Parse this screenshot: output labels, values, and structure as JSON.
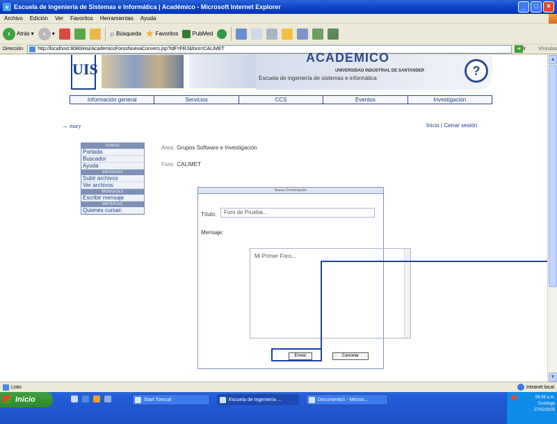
{
  "window": {
    "title": "Escuela de Ingeniería de Sistemas e Informática | Académico - Microsoft Internet Explorer"
  },
  "menubar": {
    "items": [
      "Archivo",
      "Edición",
      "Ver",
      "Favoritos",
      "Herramientas",
      "Ayuda"
    ]
  },
  "toolbar": {
    "back": "Atrás",
    "search": "Búsqueda",
    "favorites": "Favoritos",
    "pubmed": "PubMed"
  },
  "addressbar": {
    "label": "Dirección",
    "url": "http://localhost:8080/eisi/AcademicoForosNuevaConvers.jsp?idF=FRJ&foro=CALIMET",
    "go": "Ir",
    "links": "Vínculos"
  },
  "banner": {
    "logo": "UIS",
    "academico": "ACADEMICO",
    "university": "UNIVERSIDAD INDUSTRIAL DE SANTANDER",
    "school": "Escuela de ingeniería de sistemas e informática"
  },
  "nav": {
    "tabs": [
      "Información general",
      "Servicios",
      "CCS",
      "Eventos",
      "Investigación"
    ]
  },
  "user": {
    "name": "mary"
  },
  "toplinks": {
    "home": "Inicio",
    "separator": "|",
    "logout": "Cerrar sesión"
  },
  "sidemenu": {
    "sections": [
      {
        "header": "FOROS",
        "items": [
          "Portada",
          "Buscador",
          "Ayuda"
        ]
      },
      {
        "header": "ARCHIVOS",
        "items": [
          "Subir archivos",
          "Ver archivos"
        ]
      },
      {
        "header": "MENSAJES",
        "items": [
          "Escribir mensaje"
        ]
      },
      {
        "header": "MATERIAS",
        "items": [
          "Quienes cursan"
        ]
      }
    ]
  },
  "info": {
    "area_label": "Area:",
    "area_value": "Grupos Software e Investigación",
    "forum_label": "Foro:",
    "forum_value": "CALIMET"
  },
  "panel": {
    "header": "Nueva Conversación",
    "title_label": "Título:",
    "title_value": "Foro de Prueba...",
    "message_label": "Mensaje:",
    "message_value": "Mi Primer Foro...",
    "send_button": "Enviar",
    "cancel_button": "Cancelar"
  },
  "statusbar": {
    "status": "Listo",
    "zone": "Intranet local"
  },
  "taskbar": {
    "start": "Inicio",
    "tasks": [
      "Start Tomcat",
      "Escuela de Ingeniería ...",
      "Documento1 - Micros..."
    ],
    "clock": "08:39 a.m.",
    "day": "Domingo",
    "date": "27/02/2005"
  },
  "colors": {
    "accent": "#1b3e8a",
    "annotation": "#1a3fb0"
  }
}
